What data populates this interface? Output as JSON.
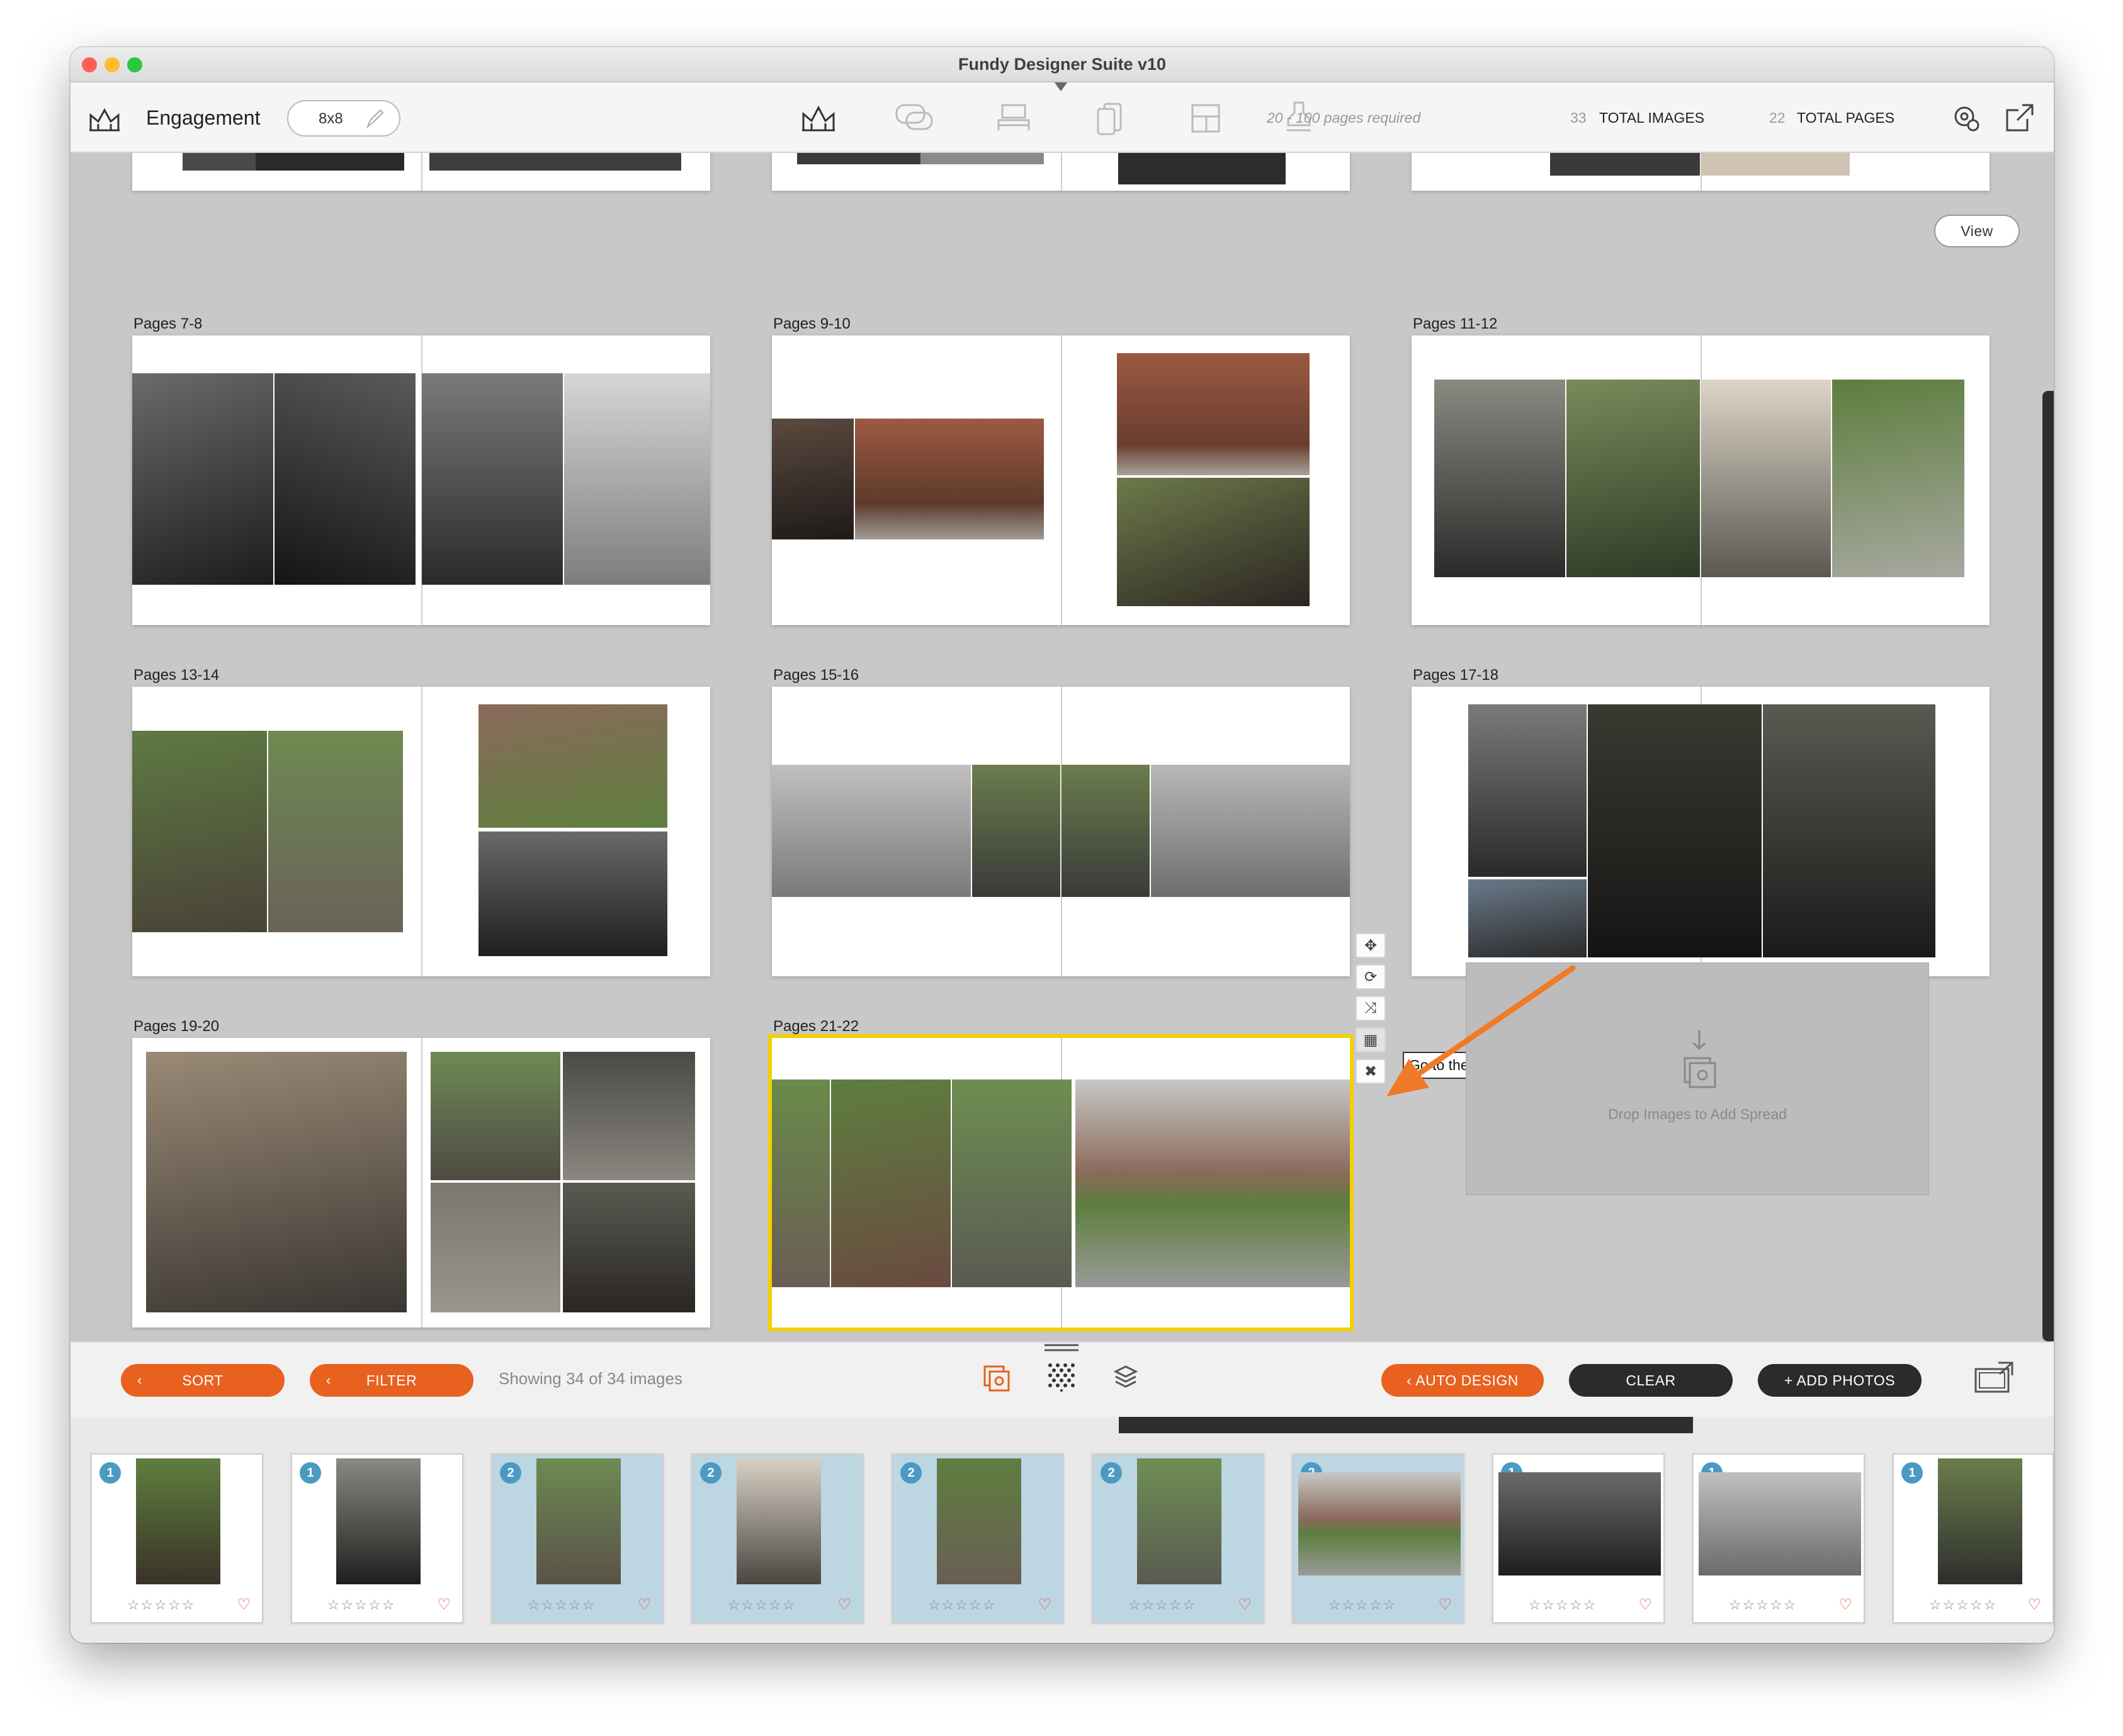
{
  "window": {
    "title": "Fundy Designer Suite v10"
  },
  "toolbar": {
    "project_name": "Engagement",
    "size": "8x8",
    "pages_required": "20 - 100 pages required",
    "total_images_count": "33",
    "total_images_label": "TOTAL IMAGES",
    "total_pages_count": "22",
    "total_pages_label": "TOTAL PAGES",
    "icons": [
      "album-icon",
      "speech-bubble-icon",
      "bed-icon",
      "phone-icon",
      "layout-icon",
      "stamp-icon",
      "settings-icon",
      "export-icon"
    ]
  },
  "canvas": {
    "view_button": "View",
    "spreads": [
      {
        "label": "Pages 7-8"
      },
      {
        "label": "Pages 9-10"
      },
      {
        "label": "Pages 11-12"
      },
      {
        "label": "Pages 13-14"
      },
      {
        "label": "Pages 15-16"
      },
      {
        "label": "Pages 17-18"
      },
      {
        "label": "Pages 19-20"
      },
      {
        "label": "Pages 21-22",
        "selected": true
      }
    ],
    "tooltip": "Go to the quick design picker.",
    "dropzone_text": "Drop Images to Add Spread",
    "selection_color": "#f4d000",
    "annotation_arrow_color": "#f07a28"
  },
  "bottombar": {
    "sort": "SORT",
    "filter": "FILTER",
    "showing": "Showing 34 of 34 images",
    "auto_design": "AUTO DESIGN",
    "clear": "CLEAR",
    "add_photos": "+ ADD PHOTOS",
    "accent": "#e8611f"
  },
  "filmstrip": {
    "thumbs": [
      {
        "badge": "1",
        "used": false
      },
      {
        "badge": "1",
        "used": false
      },
      {
        "badge": "2",
        "used": true
      },
      {
        "badge": "2",
        "used": true
      },
      {
        "badge": "2",
        "used": true
      },
      {
        "badge": "2",
        "used": true
      },
      {
        "badge": "2",
        "used": true
      },
      {
        "badge": "1",
        "used": false
      },
      {
        "badge": "1",
        "used": false
      },
      {
        "badge": "1",
        "used": false
      }
    ],
    "stars": "☆☆☆☆☆",
    "heart": "♡"
  }
}
